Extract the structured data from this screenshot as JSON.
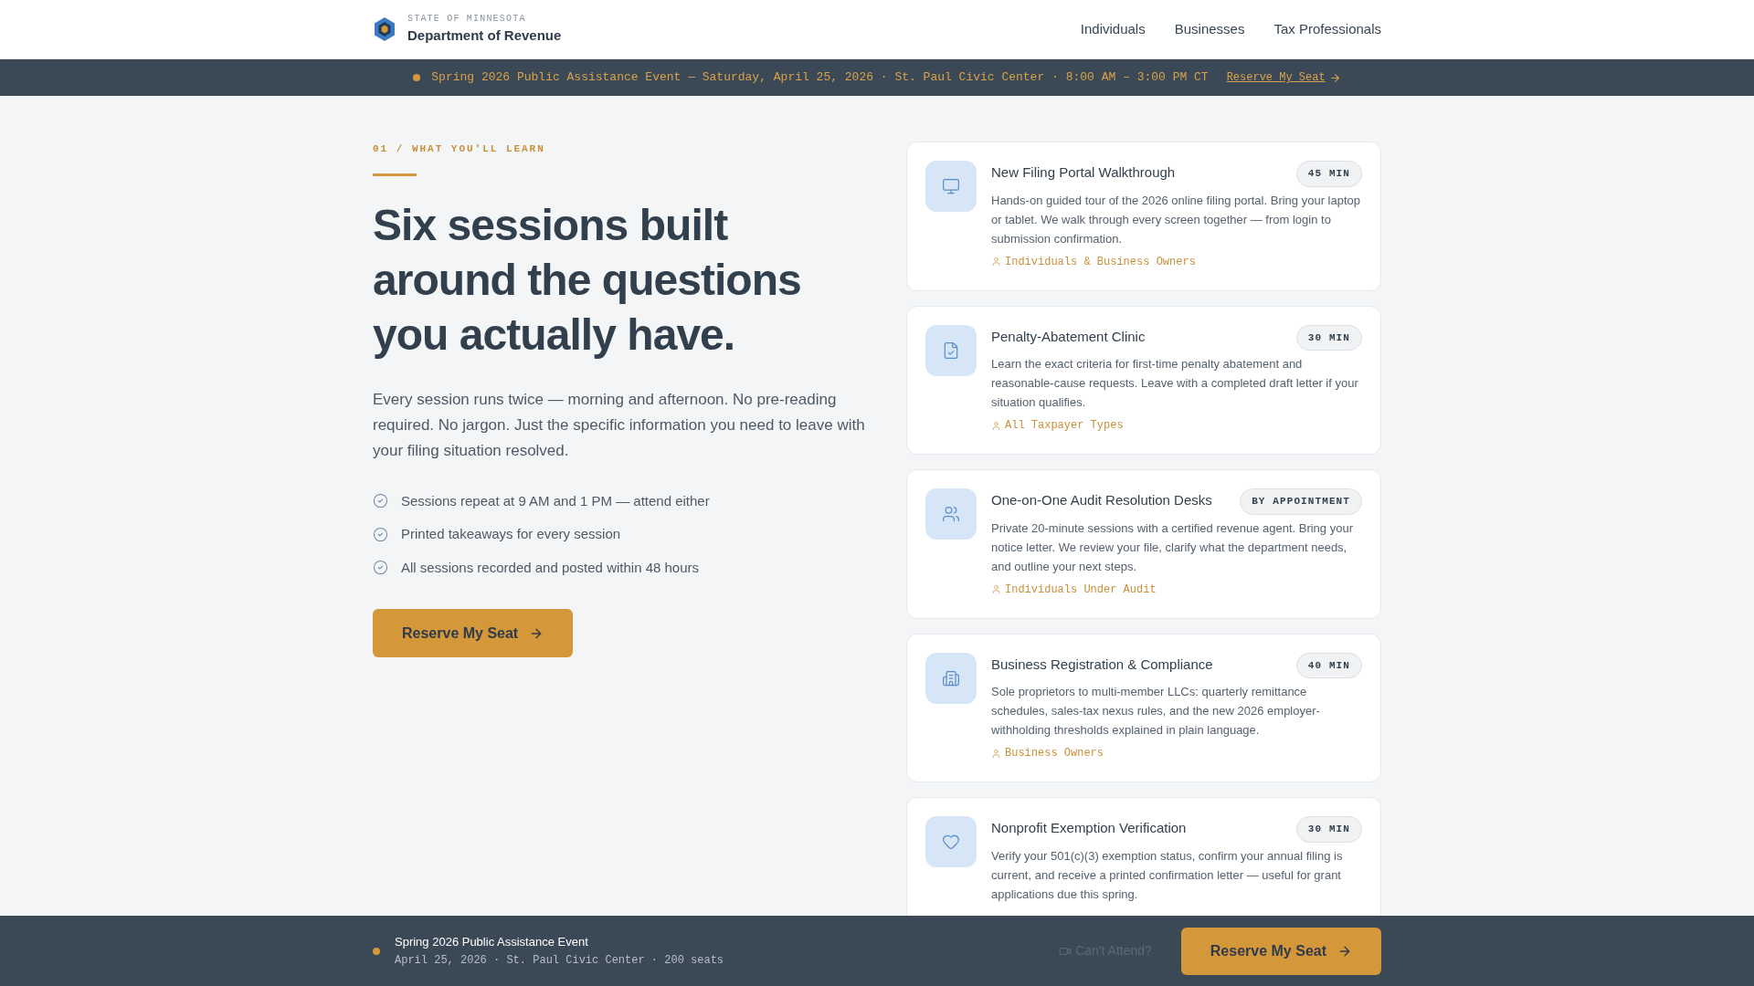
{
  "header": {
    "state": "STATE OF MINNESOTA",
    "department": "Department of Revenue",
    "nav": [
      {
        "label": "Individuals"
      },
      {
        "label": "Businesses"
      },
      {
        "label": "Tax Professionals"
      }
    ]
  },
  "banner": {
    "text": "Spring 2026 Public Assistance Event — Saturday, April 25, 2026 · St. Paul Civic Center · 8:00 AM – 3:00 PM CT",
    "link": "Reserve My Seat"
  },
  "intro": {
    "eyebrow": "01 / WHAT YOU'LL LEARN",
    "heading": "Six sessions built around the questions you actually have.",
    "lead": "Every session runs twice — morning and afternoon. No pre-reading required. No jargon. Just the specific information you need to leave with your filing situation resolved.",
    "checklist": [
      "Sessions repeat at 9 AM and 1 PM — attend either",
      "Printed takeaways for every session",
      "All sessions recorded and posted within 48 hours"
    ],
    "button": "Reserve My Seat"
  },
  "sessions": [
    {
      "kind": "monitor",
      "title": "New Filing Portal Walkthrough",
      "badge": "45 MIN",
      "description": "Hands-on guided tour of the 2026 online filing portal. Bring your laptop or tablet. We walk through every screen together — from login to submission confirmation.",
      "audience": "Individuals & Business Owners"
    },
    {
      "kind": "document",
      "title": "Penalty-Abatement Clinic",
      "badge": "30 MIN",
      "description": "Learn the exact criteria for first-time penalty abatement and reasonable-cause requests. Leave with a completed draft letter if your situation qualifies.",
      "audience": "All Taxpayer Types"
    },
    {
      "kind": "people",
      "title": "One-on-One Audit Resolution Desks",
      "badge": "BY APPOINTMENT",
      "description": "Private 20-minute sessions with a certified revenue agent. Bring your notice letter. We review your file, clarify what the department needs, and outline your next steps.",
      "audience": "Individuals Under Audit"
    },
    {
      "kind": "building",
      "title": "Business Registration & Compliance",
      "badge": "40 MIN",
      "description": "Sole proprietors to multi-member LLCs: quarterly remittance schedules, sales-tax nexus rules, and the new 2026 employer-withholding thresholds explained in plain language.",
      "audience": "Business Owners"
    },
    {
      "kind": "heart",
      "title": "Nonprofit Exemption Verification",
      "badge": "30 MIN",
      "description": "Verify your 501(c)(3) exemption status, confirm your annual filing is current, and receive a printed confirmation letter — useful for grant applications due this spring."
    }
  ],
  "footer_bar": {
    "title": "Spring 2026 Public Assistance Event",
    "details": "April 25, 2026 · St. Paul Civic Center · 200 seats",
    "secondary_link": "Can't Attend?",
    "button": "Reserve My Seat"
  }
}
